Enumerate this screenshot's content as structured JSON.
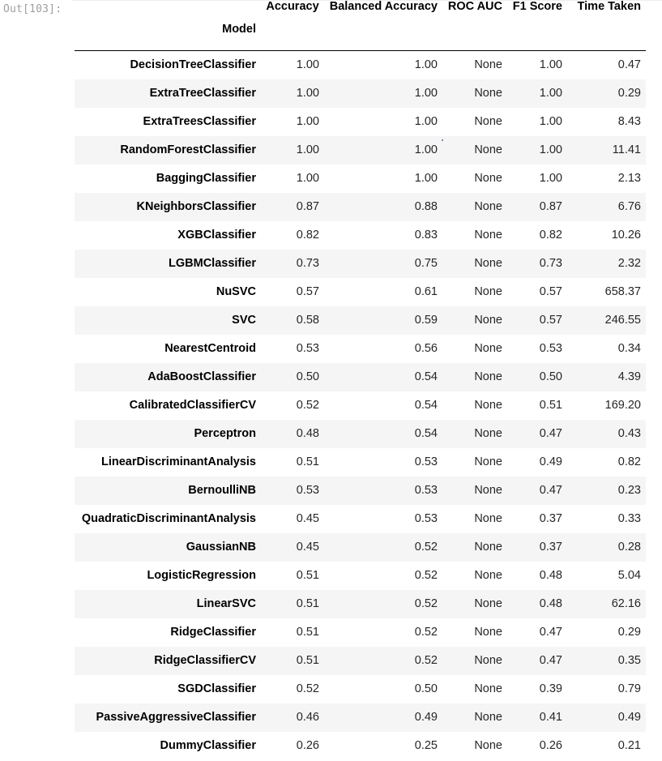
{
  "prompt": "Out[103]:",
  "table": {
    "columns": [
      "Accuracy",
      "Balanced Accuracy",
      "ROC AUC",
      "F1 Score",
      "Time Taken"
    ],
    "index_name": "Model",
    "rows": [
      {
        "model": "DecisionTreeClassifier",
        "accuracy": "1.00",
        "balanced_accuracy": "1.00",
        "roc_auc": "None",
        "f1": "1.00",
        "time": "0.47"
      },
      {
        "model": "ExtraTreeClassifier",
        "accuracy": "1.00",
        "balanced_accuracy": "1.00",
        "roc_auc": "None",
        "f1": "1.00",
        "time": "0.29"
      },
      {
        "model": "ExtraTreesClassifier",
        "accuracy": "1.00",
        "balanced_accuracy": "1.00",
        "roc_auc": "None",
        "f1": "1.00",
        "time": "8.43"
      },
      {
        "model": "RandomForestClassifier",
        "accuracy": "1.00",
        "balanced_accuracy": "1.00",
        "roc_auc": "None",
        "f1": "1.00",
        "time": "11.41"
      },
      {
        "model": "BaggingClassifier",
        "accuracy": "1.00",
        "balanced_accuracy": "1.00",
        "roc_auc": "None",
        "f1": "1.00",
        "time": "2.13"
      },
      {
        "model": "KNeighborsClassifier",
        "accuracy": "0.87",
        "balanced_accuracy": "0.88",
        "roc_auc": "None",
        "f1": "0.87",
        "time": "6.76"
      },
      {
        "model": "XGBClassifier",
        "accuracy": "0.82",
        "balanced_accuracy": "0.83",
        "roc_auc": "None",
        "f1": "0.82",
        "time": "10.26"
      },
      {
        "model": "LGBMClassifier",
        "accuracy": "0.73",
        "balanced_accuracy": "0.75",
        "roc_auc": "None",
        "f1": "0.73",
        "time": "2.32"
      },
      {
        "model": "NuSVC",
        "accuracy": "0.57",
        "balanced_accuracy": "0.61",
        "roc_auc": "None",
        "f1": "0.57",
        "time": "658.37"
      },
      {
        "model": "SVC",
        "accuracy": "0.58",
        "balanced_accuracy": "0.59",
        "roc_auc": "None",
        "f1": "0.57",
        "time": "246.55"
      },
      {
        "model": "NearestCentroid",
        "accuracy": "0.53",
        "balanced_accuracy": "0.56",
        "roc_auc": "None",
        "f1": "0.53",
        "time": "0.34"
      },
      {
        "model": "AdaBoostClassifier",
        "accuracy": "0.50",
        "balanced_accuracy": "0.54",
        "roc_auc": "None",
        "f1": "0.50",
        "time": "4.39"
      },
      {
        "model": "CalibratedClassifierCV",
        "accuracy": "0.52",
        "balanced_accuracy": "0.54",
        "roc_auc": "None",
        "f1": "0.51",
        "time": "169.20"
      },
      {
        "model": "Perceptron",
        "accuracy": "0.48",
        "balanced_accuracy": "0.54",
        "roc_auc": "None",
        "f1": "0.47",
        "time": "0.43"
      },
      {
        "model": "LinearDiscriminantAnalysis",
        "accuracy": "0.51",
        "balanced_accuracy": "0.53",
        "roc_auc": "None",
        "f1": "0.49",
        "time": "0.82"
      },
      {
        "model": "BernoulliNB",
        "accuracy": "0.53",
        "balanced_accuracy": "0.53",
        "roc_auc": "None",
        "f1": "0.47",
        "time": "0.23"
      },
      {
        "model": "QuadraticDiscriminantAnalysis",
        "accuracy": "0.45",
        "balanced_accuracy": "0.53",
        "roc_auc": "None",
        "f1": "0.37",
        "time": "0.33"
      },
      {
        "model": "GaussianNB",
        "accuracy": "0.45",
        "balanced_accuracy": "0.52",
        "roc_auc": "None",
        "f1": "0.37",
        "time": "0.28"
      },
      {
        "model": "LogisticRegression",
        "accuracy": "0.51",
        "balanced_accuracy": "0.52",
        "roc_auc": "None",
        "f1": "0.48",
        "time": "5.04"
      },
      {
        "model": "LinearSVC",
        "accuracy": "0.51",
        "balanced_accuracy": "0.52",
        "roc_auc": "None",
        "f1": "0.48",
        "time": "62.16"
      },
      {
        "model": "RidgeClassifier",
        "accuracy": "0.51",
        "balanced_accuracy": "0.52",
        "roc_auc": "None",
        "f1": "0.47",
        "time": "0.29"
      },
      {
        "model": "RidgeClassifierCV",
        "accuracy": "0.51",
        "balanced_accuracy": "0.52",
        "roc_auc": "None",
        "f1": "0.47",
        "time": "0.35"
      },
      {
        "model": "SGDClassifier",
        "accuracy": "0.52",
        "balanced_accuracy": "0.50",
        "roc_auc": "None",
        "f1": "0.39",
        "time": "0.79"
      },
      {
        "model": "PassiveAggressiveClassifier",
        "accuracy": "0.46",
        "balanced_accuracy": "0.49",
        "roc_auc": "None",
        "f1": "0.41",
        "time": "0.49"
      },
      {
        "model": "DummyClassifier",
        "accuracy": "0.26",
        "balanced_accuracy": "0.25",
        "roc_auc": "None",
        "f1": "0.26",
        "time": "0.21"
      }
    ]
  },
  "colors": {
    "stripe": "#f5f5f5",
    "header_rule": "#000000",
    "prompt": "#9e9e9e"
  }
}
